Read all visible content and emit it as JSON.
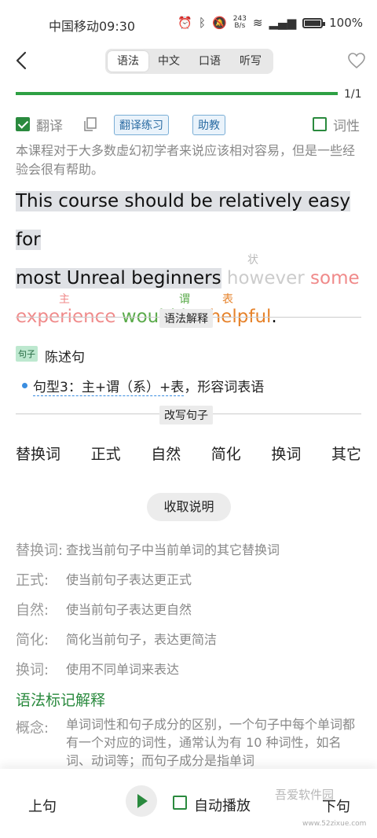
{
  "status_bar": {
    "carrier_time": "中国移动09:30",
    "net_speed_value": "243",
    "net_speed_unit": "B/s",
    "battery": "100%"
  },
  "header": {
    "tabs": [
      "语法",
      "中文",
      "口语",
      "听写"
    ],
    "active_tab": "语法"
  },
  "progress": {
    "text": "1/1",
    "fraction": 1.0
  },
  "toolbar": {
    "translate_label": "翻译",
    "translate_checked": true,
    "practice_button": "翻译练习",
    "helper_button": "助教",
    "pos_label": "词性",
    "pos_checked": false
  },
  "chinese_text": "本课程对于大多数虚幻初学者来说应该相对容易，但是一些经验会很有帮助。",
  "sentence": {
    "part1": "This course should be relatively easy for",
    "part2": "most Unreal beginners",
    "w_however": "however",
    "w_some": "some",
    "w_experience": "experience",
    "w_would_be": "would be",
    "w_helpful": "helpful",
    "period": ".",
    "label_subject": "主",
    "label_predicate": "谓",
    "label_complement": "表",
    "label_adverbial": "状"
  },
  "grammar": {
    "section_label": "语法解释",
    "sentence_tag": "句子",
    "sentence_type": "陈述句",
    "pattern_linked": "句型3：主+谓（系）+表",
    "pattern_rest": "，形容词表语"
  },
  "rewrite": {
    "section_label": "改写句子",
    "options": [
      "替换词",
      "正式",
      "自然",
      "简化",
      "换词",
      "其它"
    ],
    "collapse_button": "收取说明"
  },
  "explanations": [
    {
      "term": "替换词:",
      "desc": "查找当前句子中当前单词的其它替换词"
    },
    {
      "term": "正式:",
      "desc": "使当前句子表达更正式"
    },
    {
      "term": "自然:",
      "desc": "使当前句子表达更自然"
    },
    {
      "term": "简化:",
      "desc": "简化当前句子，表达更简洁"
    },
    {
      "term": "换词:",
      "desc": "使用不同单词来表达"
    }
  ],
  "marks": {
    "title": "语法标记解释",
    "concept_term": "概念:",
    "concept_text": "单词词性和句子成分的区别，一个句子中每个单词都有一个对应的词性，通常认为有 10 种词性，如名词、动词等；而句子成分是指单词"
  },
  "bottom": {
    "prev": "上句",
    "auto_play": "自动播放",
    "next": "下句",
    "watermark": "吾爱软件园",
    "watermark_url": "www.52zixue.com"
  },
  "colors": {
    "accent_green": "#2a8a3e",
    "subject_pink": "#f08a8a",
    "predicate_green": "#5aaa4a",
    "complement_orange": "#e6822a"
  }
}
